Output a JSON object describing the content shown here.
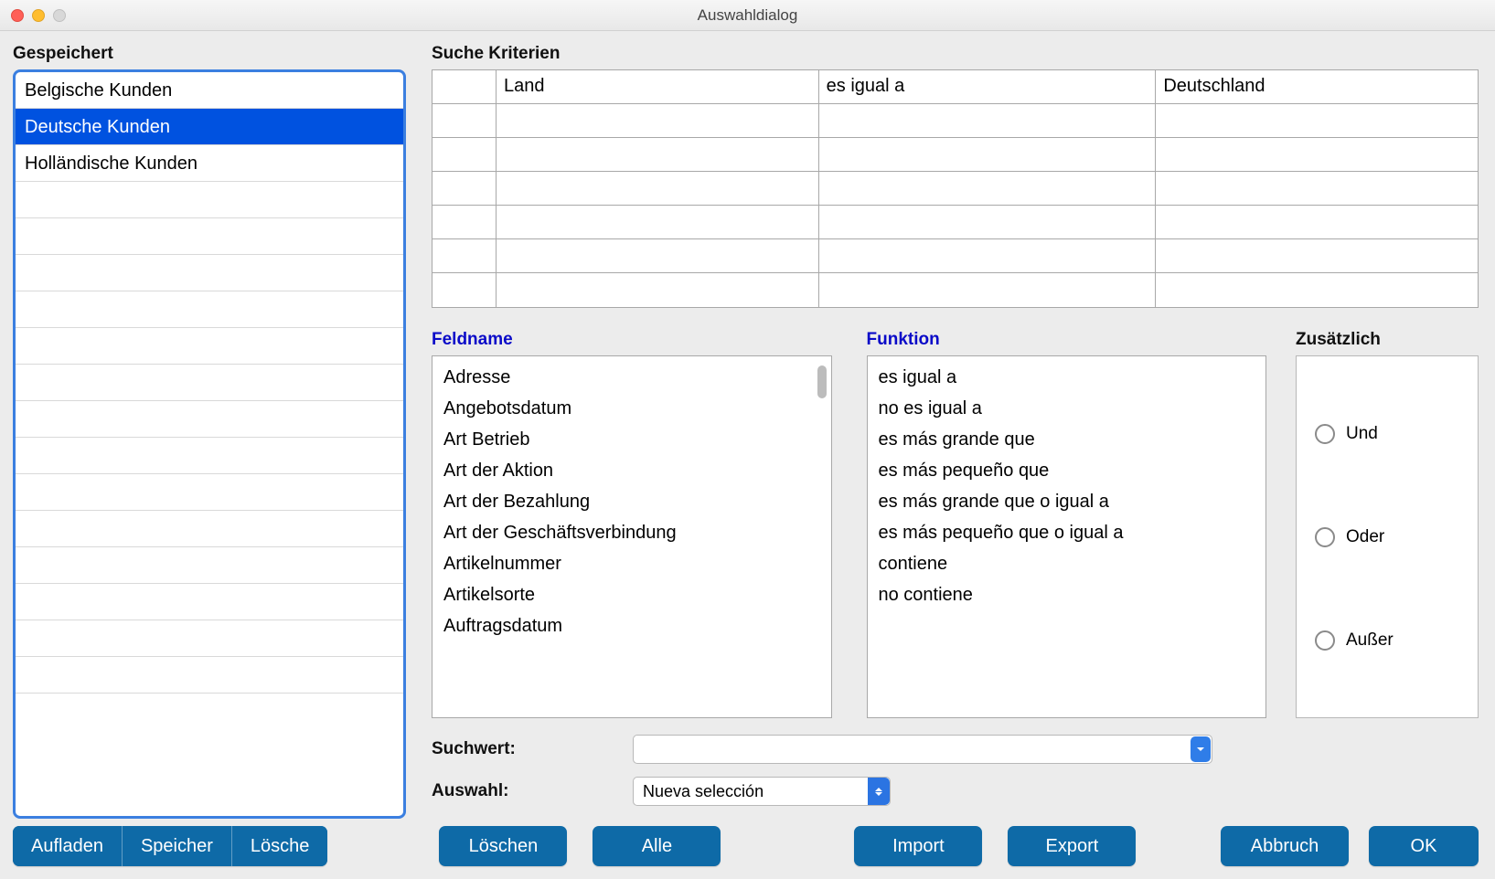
{
  "window": {
    "title": "Auswahldialog"
  },
  "saved": {
    "title": "Gespeichert",
    "items": [
      "Belgische Kunden",
      "Deutsche Kunden",
      "Holländische Kunden",
      "",
      "",
      "",
      "",
      "",
      "",
      "",
      "",
      "",
      "",
      "",
      "",
      "",
      ""
    ],
    "selectedIndex": 1
  },
  "criteria": {
    "title": "Suche Kriterien",
    "rows": [
      {
        "op": "",
        "field": "Land",
        "func": "es igual a",
        "value": "Deutschland"
      },
      {
        "op": "",
        "field": "",
        "func": "",
        "value": ""
      },
      {
        "op": "",
        "field": "",
        "func": "",
        "value": ""
      },
      {
        "op": "",
        "field": "",
        "func": "",
        "value": ""
      },
      {
        "op": "",
        "field": "",
        "func": "",
        "value": ""
      },
      {
        "op": "",
        "field": "",
        "func": "",
        "value": ""
      },
      {
        "op": "",
        "field": "",
        "func": "",
        "value": ""
      }
    ]
  },
  "fieldcol": {
    "title": "Feldname",
    "items": [
      "Adresse",
      "Angebotsdatum",
      "Art Betrieb",
      "Art der Aktion",
      "Art der Bezahlung",
      "Art der Geschäftsverbindung",
      "Artikelnummer",
      "Artikelsorte",
      "Auftragsdatum"
    ]
  },
  "funccol": {
    "title": "Funktion",
    "items": [
      "es igual a",
      "no es igual a",
      "es más grande que",
      "es más pequeño que",
      "es más grande que o igual a",
      "es más pequeño que o igual a",
      "contiene",
      "no contiene"
    ]
  },
  "extra": {
    "title": "Zusätzlich",
    "options": [
      "Und",
      "Oder",
      "Außer"
    ]
  },
  "form": {
    "searchvalue_label": "Suchwert:",
    "searchvalue": "",
    "selection_label": "Auswahl:",
    "selection": "Nueva selección"
  },
  "buttons": {
    "aufladen": "Aufladen",
    "speicher": "Speicher",
    "loesche": "Lösche",
    "loeschen": "Löschen",
    "alle": "Alle",
    "import": "Import",
    "export": "Export",
    "abbruch": "Abbruch",
    "ok": "OK"
  }
}
